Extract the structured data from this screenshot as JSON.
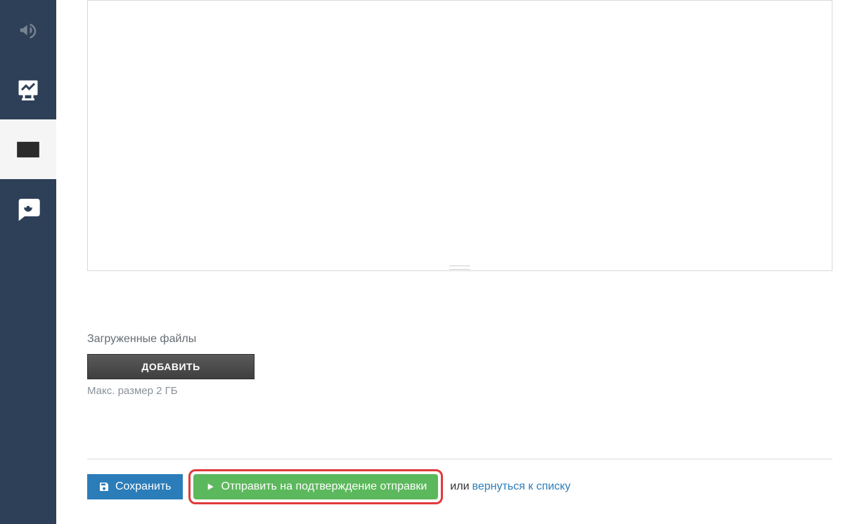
{
  "sidebar": {
    "items": [
      {
        "name": "announce",
        "icon": "megaphone-icon"
      },
      {
        "name": "presentation",
        "icon": "presentation-chart-icon"
      },
      {
        "name": "mail",
        "icon": "envelope-icon",
        "active": true
      },
      {
        "name": "chat",
        "icon": "chat-icon"
      }
    ]
  },
  "upload": {
    "label": "Загруженные файлы",
    "add_button": "ДОБАВИТЬ",
    "hint": "Макс. размер 2 ГБ"
  },
  "actions": {
    "save_label": "Сохранить",
    "send_label": "Отправить на подтверждение отправки",
    "or_text": "или",
    "back_link": "вернуться к списку"
  }
}
